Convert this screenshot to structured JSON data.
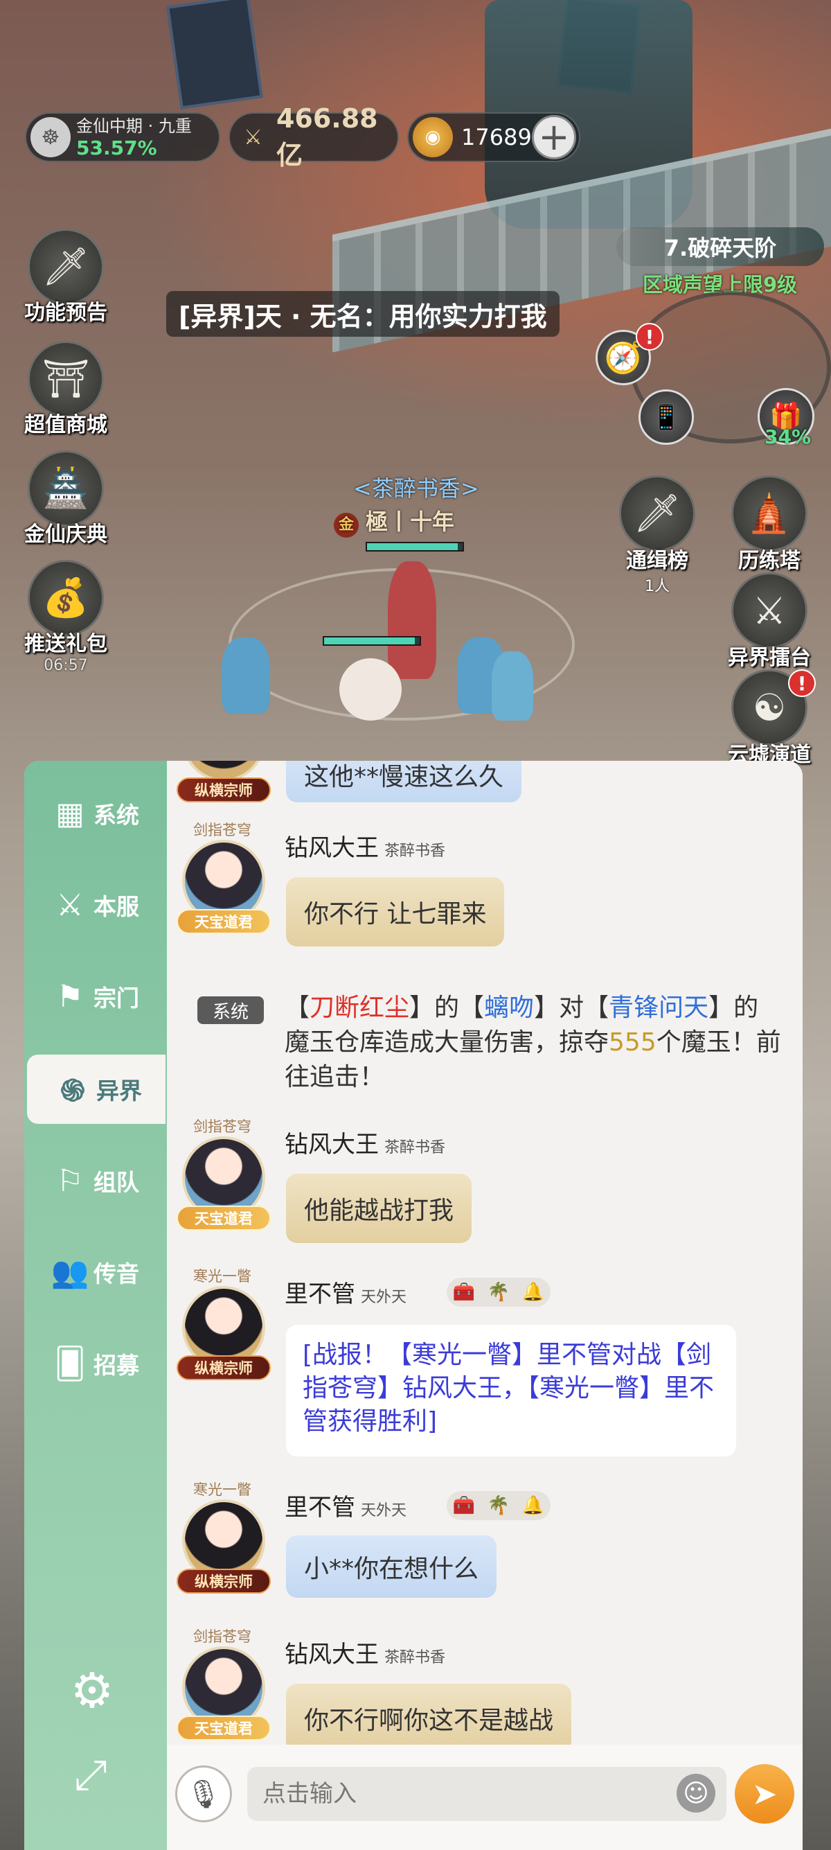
{
  "hud": {
    "rank_title": "金仙中期 · 九重",
    "rank_progress": "53.57%",
    "combat_power": "466.88亿",
    "spirit_stones": "17689"
  },
  "left_buttons": [
    {
      "label": "功能预告",
      "icon": "sword-icon"
    },
    {
      "label": "超值商城",
      "icon": "shop-icon"
    },
    {
      "label": "金仙庆典",
      "icon": "palace-icon"
    },
    {
      "label": "推送礼包",
      "icon": "gift-bag-icon",
      "timer": "06:57"
    }
  ],
  "zone": {
    "name": "7.破碎天阶",
    "reputation_cap": "区域声望上限9级"
  },
  "right_buttons": {
    "chest_progress": "34%",
    "wanted": {
      "label": "通缉榜",
      "sub": "1人"
    },
    "trial_tower": {
      "label": "历练塔"
    },
    "arena": {
      "label": "异界擂台"
    },
    "cloud_ruins": {
      "label": "云墟演道"
    }
  },
  "scene": {
    "shout": "[异界]天 · 无名：用你实力打我",
    "char_name": "<茶醉书香>",
    "char_title_badge": "金",
    "char_title": "極丨十年",
    "hp_fraction": 0.95
  },
  "chat": {
    "tabs": [
      {
        "label": "系统",
        "icon": "grid-icon"
      },
      {
        "label": "本服",
        "icon": "crossed-swords-icon"
      },
      {
        "label": "宗门",
        "icon": "banner-icon"
      },
      {
        "label": "异界",
        "icon": "vortex-icon",
        "active": true
      },
      {
        "label": "组队",
        "icon": "flag-icon"
      },
      {
        "label": "传音",
        "icon": "people-icon"
      },
      {
        "label": "招募",
        "icon": "cards-icon"
      }
    ],
    "messages": {
      "m0": {
        "badge": "纵横宗师",
        "text": "这他**慢速这么久"
      },
      "m1": {
        "guild": "剑指苍穹",
        "badge": "天宝道君",
        "name": "钻风大王",
        "sub": "茶醉书香",
        "text": "你不行 让七罪来"
      },
      "m2": {
        "tag": "系统",
        "p1": "【",
        "p2": "刀断红尘",
        "p3": "】的【",
        "p4": "螭吻",
        "p5": "】对【",
        "p6": "青锋问天",
        "p7": "】的魔玉仓库造成大量伤害，掠夺",
        "p8": "555",
        "p9": "个魔玉！前往追击！"
      },
      "m3": {
        "guild": "剑指苍穹",
        "badge": "天宝道君",
        "name": "钻风大王",
        "sub": "茶醉书香",
        "text": "他能越战打我"
      },
      "m4": {
        "guild": "寒光一瞥",
        "badge": "纵横宗师",
        "name": "里不管",
        "sub": "天外天",
        "text": "[战报！【寒光一瞥】里不管对战【剑指苍穹】钻风大王，【寒光一瞥】里不管获得胜利]"
      },
      "m5": {
        "guild": "寒光一瞥",
        "badge": "纵横宗师",
        "name": "里不管",
        "sub": "天外天",
        "text": "小**你在想什么"
      },
      "m6": {
        "guild": "剑指苍穹",
        "badge": "天宝道君",
        "name": "钻风大王",
        "sub": "茶醉书香",
        "text": "你不行啊你这不是越战"
      }
    },
    "input_placeholder": "点击输入"
  },
  "colors": {
    "panel_green": "#8fc9a8",
    "accent_orange": "#ee8c1c",
    "hp_teal": "#4fd3b5",
    "highlight_red": "#e0302a",
    "highlight_blue": "#2f6fd8"
  }
}
